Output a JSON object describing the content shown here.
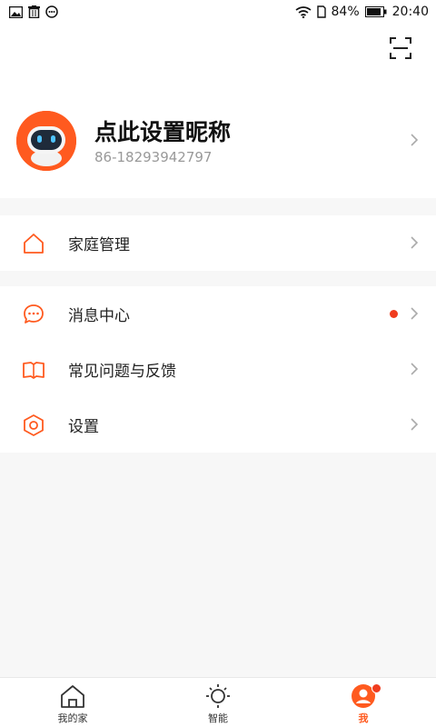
{
  "status_bar": {
    "battery": "84%",
    "time": "20:40",
    "left_icons": [
      "image-icon",
      "trash-icon",
      "message-icon"
    ],
    "right_icons": [
      "wifi-icon",
      "sim-icon",
      "battery-icon"
    ]
  },
  "profile": {
    "nickname": "点此设置昵称",
    "phone": "86-18293942797"
  },
  "menu": {
    "family": {
      "label": "家庭管理",
      "icon": "home-icon"
    },
    "messages": {
      "label": "消息中心",
      "icon": "chat-icon",
      "has_unread": true
    },
    "faq": {
      "label": "常见问题与反馈",
      "icon": "book-icon"
    },
    "settings": {
      "label": "设置",
      "icon": "hexagon-settings-icon"
    }
  },
  "tabs": [
    {
      "label": "我的家",
      "icon": "home-icon",
      "active": false
    },
    {
      "label": "智能",
      "icon": "sun-icon",
      "active": false
    },
    {
      "label": "我",
      "icon": "user-icon",
      "active": true,
      "badge": true
    }
  ],
  "colors": {
    "accent": "#ff5a1f",
    "badge": "#f03c1e",
    "background": "#f7f7f7"
  }
}
